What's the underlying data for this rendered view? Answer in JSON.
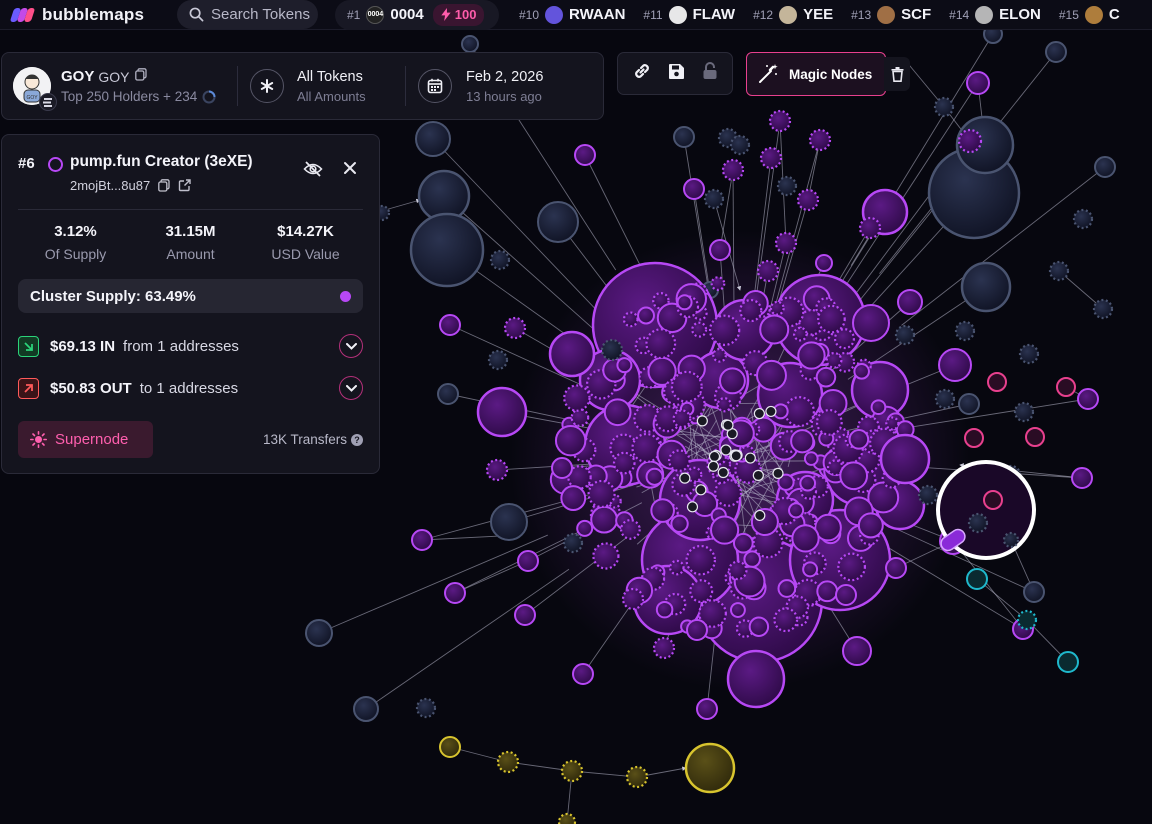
{
  "app": {
    "name": "bubblemaps"
  },
  "topbar": {
    "search_label": "Search Tokens",
    "featured": {
      "rank": "#1",
      "icon_text": "0004",
      "name": "0004",
      "boost": "100",
      "icon_color": "#222222"
    },
    "trending": [
      {
        "rank": "#10",
        "name": "RWAAN",
        "icon": "rwaan-logo-icon",
        "color": "#6d5cf2"
      },
      {
        "rank": "#11",
        "name": "FLAW",
        "icon": "flaw-logo-icon",
        "color": "#ffffff"
      },
      {
        "rank": "#12",
        "name": "YEE",
        "icon": "yee-logo-icon",
        "color": "#d8c8a8"
      },
      {
        "rank": "#13",
        "name": "SCF",
        "icon": "scf-logo-icon",
        "color": "#b07a4a"
      },
      {
        "rank": "#14",
        "name": "ELON",
        "icon": "elon-logo-icon",
        "color": "#c8c8c8"
      },
      {
        "rank": "#15",
        "name": "C",
        "icon": "c-logo-icon",
        "color": "#c08a40"
      }
    ]
  },
  "token": {
    "name": "GOY",
    "symbol": "GOY",
    "holders_label": "Top 250 Holders + 234",
    "filter_title": "All Tokens",
    "filter_sub": "All Amounts",
    "date_title": "Feb 2, 2026",
    "date_sub": "13 hours ago"
  },
  "toolbar": {
    "magic_label": "Magic Nodes"
  },
  "node": {
    "rank": "#6",
    "title": "pump.fun Creator (3eXE)",
    "address": "2mojBt...8u87",
    "stats": [
      {
        "value": "3.12%",
        "label": "Of Supply"
      },
      {
        "value": "31.15M",
        "label": "Amount"
      },
      {
        "value": "$14.27K",
        "label": "USD Value"
      }
    ],
    "cluster_label": "Cluster Supply: 63.49%",
    "flow_in": {
      "amount": "$69.13 IN",
      "text": "from 1 addresses"
    },
    "flow_out": {
      "amount": "$50.83 OUT",
      "text": "to 1 addresses"
    },
    "supernode_label": "Supernode",
    "transfers_label": "13K Transfers"
  },
  "colors": {
    "purple": "#b748f5",
    "pink": "#e8408e",
    "navy": "#4a5470",
    "cyan": "#1fb8cc",
    "gold": "#d8c42e"
  }
}
